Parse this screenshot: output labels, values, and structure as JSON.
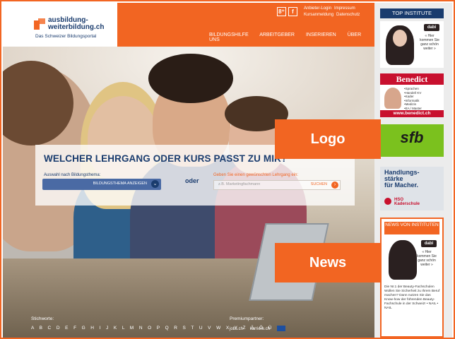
{
  "header": {
    "logo_title": "ausbildung-\nweiterbildung.ch",
    "logo_subtitle": "Das Schweizer Bildungsportal",
    "social": {
      "gplus": "8⁺",
      "facebook": "f"
    },
    "top_links": [
      "Anbieter-Login",
      "Impressum",
      "Kursanmeldung",
      "Datenschutz"
    ],
    "nav": [
      "BILDUNGSHILFE",
      "ARBEITGEBER",
      "INSERIEREN",
      "ÜBER UNS"
    ]
  },
  "search": {
    "title": "WELCHER LEHRGANG ODER KURS PASST ZU MIR?",
    "left_label": "Auswahl nach Bildungsthema:",
    "select_value": "BILDUNGSTHEMA ANZEIGEN",
    "or_text": "oder",
    "right_label": "Geben Sie einen gewünschten Lehrgang ein:",
    "input_placeholder": "z.B. Marketingfachmann",
    "submit_label": "SUCHEN"
  },
  "footer": {
    "keywords_label": "Stichworte:",
    "alphabet": "A B C D E F G H I J K L M N O P Q R S T U V W X Y Z Ä Ö Ü",
    "premium_label": "Premiumpartner:",
    "partners": [
      "jobs.ch",
      "karriere.ch"
    ]
  },
  "sidebar": {
    "top_title": "TOP INSTITUTE",
    "dabi_badge": "dabi",
    "dabi_text": "« Hier kommen Sie ganz schön weiter »",
    "benedict_title": "Benedict",
    "benedict_items": [
      "•Sprachen",
      "•Handel/ KV",
      "•Kader",
      "•Informatik",
      "•Medizin",
      "•EA / Master"
    ],
    "benedict_url": "www.benedict.ch",
    "sfb_text": "sfb",
    "hso_text": "Handlungs-\nstärke\nfür Macher.",
    "hso_name": "HSO\nKaderschule",
    "news_title": "NEWS VON INSTITUTEN",
    "news_body": "Die Nr.1 der Beauty-Fachschulen Wollen Sie Sicherheit zu Ihrem Beruf machen? Dann nutzen Sie das Know-how der führenden Beauty-Fachschule in der Schweiz! • NAIL • NAIL"
  },
  "annotations": {
    "logo": "Logo",
    "news": "News"
  },
  "colors": {
    "brand_orange": "#f26522",
    "brand_navy": "#1a3c6e"
  }
}
